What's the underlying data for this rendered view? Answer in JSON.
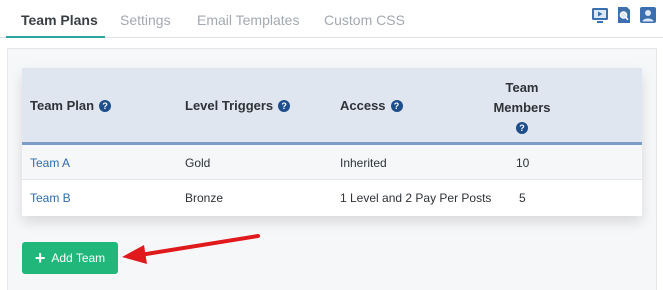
{
  "tabs": [
    {
      "label": "Team Plans",
      "active": true
    },
    {
      "label": "Settings",
      "active": false
    },
    {
      "label": "Email Templates",
      "active": false
    },
    {
      "label": "Custom CSS",
      "active": false
    }
  ],
  "top_icons": [
    "video-tutorial-icon",
    "search-doc-icon",
    "user-support-icon"
  ],
  "table": {
    "headers": {
      "team_plan": "Team Plan",
      "level_triggers": "Level Triggers",
      "access": "Access",
      "team_members_line1": "Team",
      "team_members_line2": "Members"
    },
    "help_glyph": "?",
    "rows": [
      {
        "team_plan": "Team A",
        "level_trigger": "Gold",
        "access": "Inherited",
        "members": "10"
      },
      {
        "team_plan": "Team B",
        "level_trigger": "Bronze",
        "access": "1 Level and 2 Pay Per Posts",
        "members": "5"
      }
    ]
  },
  "add_button": {
    "icon": "+",
    "label": "Add Team"
  },
  "colors": {
    "accent": "#2aa79b",
    "button": "#22b77a",
    "header_bg": "#dfe6f0",
    "link": "#2e6ba5",
    "arrow": "#e0191c"
  }
}
